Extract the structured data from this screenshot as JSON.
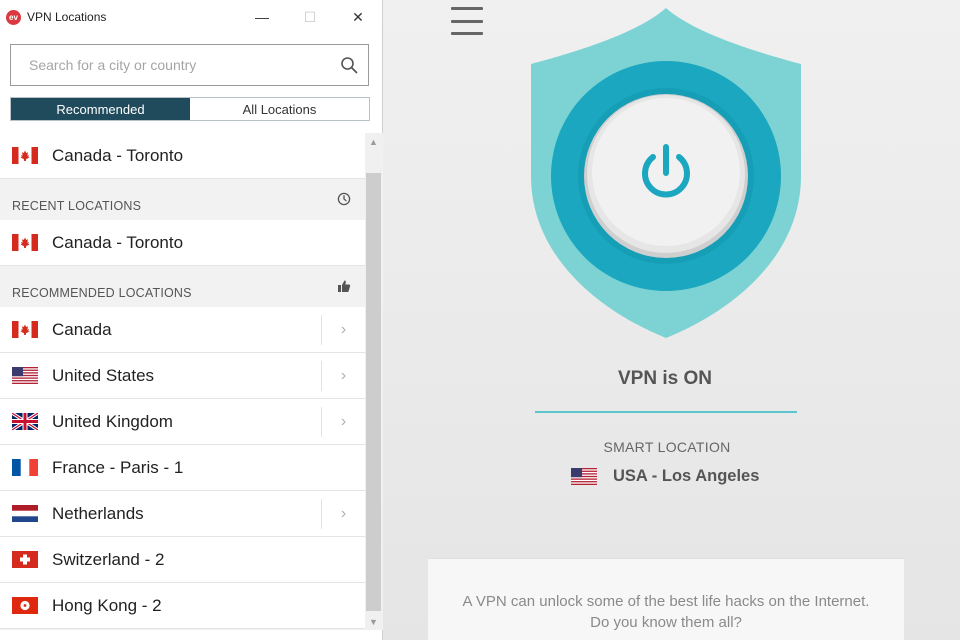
{
  "window": {
    "title": "VPN Locations",
    "logo_text": "ev",
    "minimize_glyph": "—",
    "maximize_glyph": "☐",
    "close_glyph": "✕"
  },
  "search": {
    "placeholder": "Search for a city or country",
    "value": "",
    "icon": "search-icon"
  },
  "tabs": [
    {
      "label": "Recommended",
      "active": true
    },
    {
      "label": "All Locations",
      "active": false
    }
  ],
  "top_location": {
    "label": "Canada - Toronto",
    "flag": "canada"
  },
  "recent": {
    "header": "RECENT LOCATIONS",
    "icon": "clock-icon",
    "items": [
      {
        "label": "Canada - Toronto",
        "flag": "canada"
      }
    ]
  },
  "recommended": {
    "header": "RECOMMENDED LOCATIONS",
    "icon": "thumbs-up-icon",
    "items": [
      {
        "label": "Canada",
        "flag": "canada",
        "expandable": true
      },
      {
        "label": "United States",
        "flag": "usa",
        "expandable": true
      },
      {
        "label": "United Kingdom",
        "flag": "uk",
        "expandable": true
      },
      {
        "label": "France - Paris - 1",
        "flag": "france",
        "expandable": false
      },
      {
        "label": "Netherlands",
        "flag": "netherlands",
        "expandable": true
      },
      {
        "label": "Switzerland - 2",
        "flag": "switzerland",
        "expandable": false
      },
      {
        "label": "Hong Kong - 2",
        "flag": "hongkong",
        "expandable": false
      }
    ]
  },
  "main": {
    "status": "VPN is ON",
    "smart_location_label": "SMART LOCATION",
    "smart_location": "USA - Los Angeles",
    "smart_location_flag": "usa",
    "tip": "A VPN can unlock some of the best life hacks on the Internet. Do you know them all?"
  },
  "colors": {
    "accent_dark": "#1f4b5c",
    "shield_teal": "#7dd3d3",
    "ring_teal": "#1ba7bf",
    "power_icon": "#1ba7bf",
    "status_line": "#5cc6cf"
  }
}
